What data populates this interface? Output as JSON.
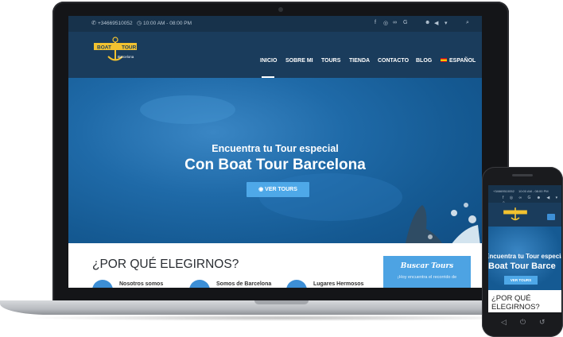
{
  "laptop": {
    "topbar": {
      "phone": "+34669510052",
      "hours": "10:00 AM - 08:00 PM",
      "social_icons": [
        "facebook-icon",
        "instagram-icon",
        "tripadvisor-icon",
        "google-icon"
      ],
      "tool_icons": [
        "user-icon",
        "volume-icon",
        "cart-icon",
        "search-icon"
      ]
    },
    "logo": {
      "top": "BOAT",
      "right": "TOUR",
      "bottom": "Barcelona"
    },
    "nav": [
      "INICIO",
      "SOBRE MI",
      "TOURS",
      "TIENDA",
      "CONTACTO",
      "BLOG",
      "ESPAÑOL"
    ],
    "hero": {
      "subtitle": "Encuentra tu Tour especial",
      "title": "Con Boat Tour Barcelona",
      "button": "VER TOURS"
    },
    "section": {
      "heading": "¿POR QUÉ ELEGIRNOS?",
      "features": [
        "Nosotros somos",
        "Somos de Barcelona",
        "Lugares Hermosos"
      ]
    },
    "search_box": {
      "title": "Buscar Tours",
      "text": "¡Hoy encuentra el recorrido de"
    }
  },
  "phone": {
    "topbar": {
      "phone": "+34669510052",
      "hours": "10:00 AM - 08:00 PM"
    },
    "hero": {
      "subtitle": "Encuentra tu Tour especial",
      "title": "Boat Tour Barce",
      "button": "VER TOURS"
    },
    "heading": "¿POR QUÉ ELEGIRNOS?"
  },
  "colors": {
    "navy": "#1a3c5c",
    "topbar": "#17324b",
    "accent": "#4ea8e8",
    "sea": "#155a93"
  }
}
